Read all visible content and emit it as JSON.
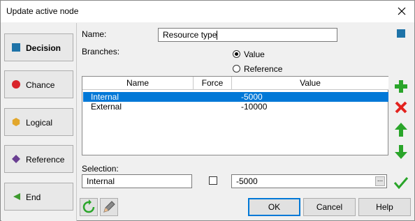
{
  "window": {
    "title": "Update active node",
    "close_icon": "close-icon"
  },
  "node_types": [
    {
      "label": "Decision",
      "icon": "blue-square-icon",
      "color": "#1e73a8",
      "active": true
    },
    {
      "label": "Chance",
      "icon": "red-circle-icon",
      "color": "#d9242b",
      "active": false
    },
    {
      "label": "Logical",
      "icon": "yellow-hexagon-icon",
      "color": "#e2a72c",
      "active": false
    },
    {
      "label": "Reference",
      "icon": "purple-diamond-icon",
      "color": "#6a3f92",
      "active": false
    },
    {
      "label": "End",
      "icon": "green-triangle-icon",
      "color": "#3e9a2f",
      "active": false
    }
  ],
  "form": {
    "name_label": "Name:",
    "name_value": "Resource type",
    "branches_label": "Branches:",
    "radio_value": "Value",
    "radio_reference": "Reference",
    "radio_selected": "Value",
    "selection_label": "Selection:"
  },
  "table": {
    "columns": [
      "Name",
      "Force",
      "Value"
    ],
    "rows": [
      {
        "name": "Internal",
        "force": "",
        "value": "-5000",
        "selected": true
      },
      {
        "name": "External",
        "force": "",
        "value": "-10000",
        "selected": false
      }
    ]
  },
  "selection": {
    "name": "Internal",
    "force_checked": false,
    "value": "-5000",
    "ellipsis": "..."
  },
  "buttons": {
    "ok": "OK",
    "cancel": "Cancel",
    "help": "Help"
  },
  "colors": {
    "accent": "#0078d7",
    "add": "#2aa52a",
    "delete": "#e3231f"
  }
}
